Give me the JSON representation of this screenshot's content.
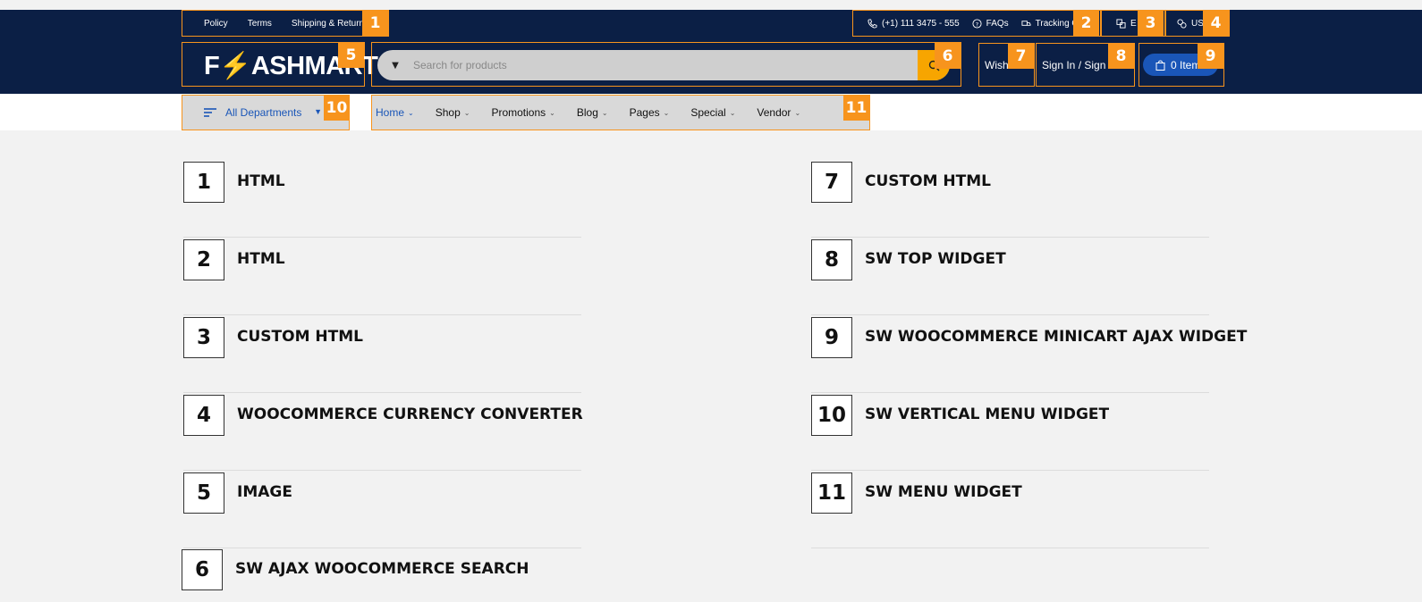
{
  "top_links": [
    "Policy",
    "Terms",
    "Shipping & Return"
  ],
  "contact": {
    "phone": "(+1) 111 3475 - 555",
    "faqs": "FAQs",
    "tracking": "Tracking Or"
  },
  "language_short": "E",
  "currency_short": "US",
  "logo": {
    "text_before": "F",
    "bolt": "⚡",
    "text_after": "ASHMART"
  },
  "search": {
    "placeholder": "Search for products"
  },
  "wishlist_label": "Wishl",
  "signin_label": "Sign In / Sign U",
  "cart_label": "0 Item",
  "departments_label": "All Departments",
  "menu": [
    {
      "label": "Home",
      "active": true
    },
    {
      "label": "Shop",
      "active": false
    },
    {
      "label": "Promotions",
      "active": false
    },
    {
      "label": "Blog",
      "active": false
    },
    {
      "label": "Pages",
      "active": false
    },
    {
      "label": "Special",
      "active": false
    },
    {
      "label": "Vendor",
      "active": false
    }
  ],
  "badges": [
    "1",
    "2",
    "3",
    "4",
    "5",
    "6",
    "7",
    "8",
    "9",
    "10",
    "11"
  ],
  "legend_left": [
    {
      "num": "1",
      "label": "HTML"
    },
    {
      "num": "2",
      "label": "HTML"
    },
    {
      "num": "3",
      "label": "CUSTOM HTML"
    },
    {
      "num": "4",
      "label": "WOOCOMMERCE CURRENCY CONVERTER"
    },
    {
      "num": "5",
      "label": "IMAGE"
    },
    {
      "num": "6",
      "label": "SW AJAX WOOCOMMERCE SEARCH"
    }
  ],
  "legend_right": [
    {
      "num": "7",
      "label": "CUSTOM HTML"
    },
    {
      "num": "8",
      "label": "SW TOP WIDGET"
    },
    {
      "num": "9",
      "label": "SW WOOCOMMERCE MINICART AJAX WIDGET"
    },
    {
      "num": "10",
      "label": "SW VERTICAL MENU WIDGET"
    },
    {
      "num": "11",
      "label": "SW MENU WIDGET"
    }
  ]
}
